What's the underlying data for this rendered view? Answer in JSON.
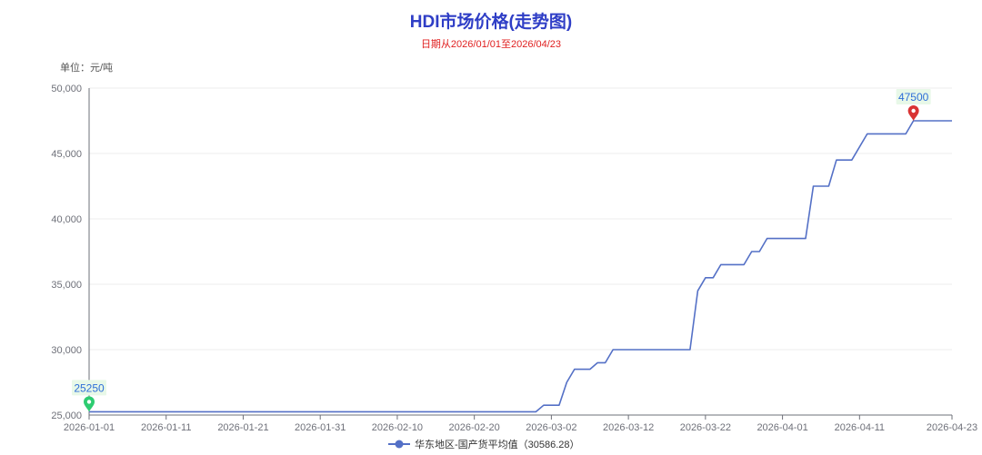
{
  "chart_data": {
    "type": "line",
    "title": "HDI市场价格(走势图)",
    "subtitle": "日期从2026/01/01至2026/04/23",
    "unit_label": "单位：元/吨",
    "ylim": [
      25000,
      50000
    ],
    "y_ticks": [
      "25,000",
      "30,000",
      "35,000",
      "40,000",
      "45,000",
      "50,000"
    ],
    "x_tick_labels": [
      "2026-01-01",
      "2026-01-11",
      "2026-01-21",
      "2026-01-31",
      "2026-02-10",
      "2026-02-20",
      "2026-03-02",
      "2026-03-12",
      "2026-03-22",
      "2026-04-01",
      "2026-04-11",
      "2026-04-23"
    ],
    "grid": true,
    "legend_position": "bottom",
    "line_color": "#5470c6",
    "series": [
      {
        "name": "华东地区-国产货平均值（30586.28）",
        "points": [
          [
            "2026-01-01",
            25250
          ],
          [
            "2026-02-28",
            25250
          ],
          [
            "2026-03-01",
            25750
          ],
          [
            "2026-03-03",
            25750
          ],
          [
            "2026-03-04",
            27500
          ],
          [
            "2026-03-05",
            28500
          ],
          [
            "2026-03-07",
            28500
          ],
          [
            "2026-03-08",
            29000
          ],
          [
            "2026-03-09",
            29000
          ],
          [
            "2026-03-10",
            30000
          ],
          [
            "2026-03-20",
            30000
          ],
          [
            "2026-03-21",
            34500
          ],
          [
            "2026-03-22",
            35500
          ],
          [
            "2026-03-23",
            35500
          ],
          [
            "2026-03-24",
            36500
          ],
          [
            "2026-03-27",
            36500
          ],
          [
            "2026-03-28",
            37500
          ],
          [
            "2026-03-29",
            37500
          ],
          [
            "2026-03-30",
            38500
          ],
          [
            "2026-04-04",
            38500
          ],
          [
            "2026-04-05",
            42500
          ],
          [
            "2026-04-07",
            42500
          ],
          [
            "2026-04-08",
            44500
          ],
          [
            "2026-04-10",
            44500
          ],
          [
            "2026-04-12",
            46500
          ],
          [
            "2026-04-17",
            46500
          ],
          [
            "2026-04-18",
            47500
          ],
          [
            "2026-04-23",
            47500
          ]
        ]
      }
    ],
    "annotations": [
      {
        "label": "25250",
        "date": "2026-01-01",
        "value": 25250,
        "kind": "min",
        "color": "#2ecc71"
      },
      {
        "label": "47500",
        "date": "2026-04-18",
        "value": 47500,
        "kind": "max",
        "color": "#d93333"
      }
    ]
  }
}
